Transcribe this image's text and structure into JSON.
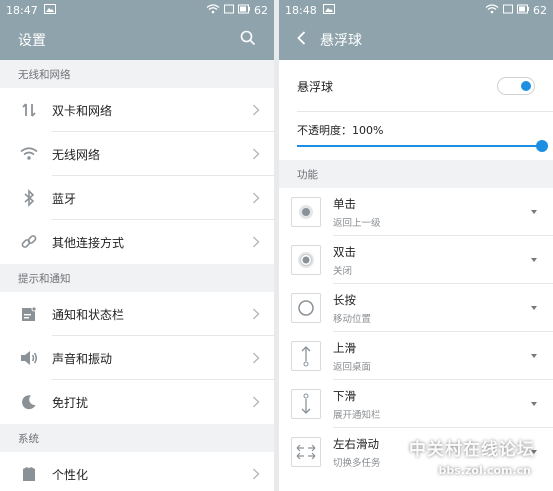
{
  "left": {
    "status": {
      "time": "18:47",
      "battery": "62"
    },
    "title": "设置",
    "sections": [
      {
        "label": "无线和网络",
        "items": [
          {
            "label": "双卡和网络",
            "icon": "dual-sim-icon"
          },
          {
            "label": "无线网络",
            "icon": "wifi-icon"
          },
          {
            "label": "蓝牙",
            "icon": "bluetooth-icon"
          },
          {
            "label": "其他连接方式",
            "icon": "link-icon"
          }
        ]
      },
      {
        "label": "提示和通知",
        "items": [
          {
            "label": "通知和状态栏",
            "icon": "notification-icon"
          },
          {
            "label": "声音和振动",
            "icon": "sound-icon"
          },
          {
            "label": "免打扰",
            "icon": "moon-icon"
          }
        ]
      },
      {
        "label": "系统",
        "items": [
          {
            "label": "个性化",
            "icon": "personalize-icon"
          }
        ]
      }
    ]
  },
  "right": {
    "status": {
      "time": "18:48",
      "battery": "62"
    },
    "title": "悬浮球",
    "toggle_label": "悬浮球",
    "toggle_on": true,
    "opacity_label": "不透明度：100%",
    "opacity_value": 1.0,
    "section_label": "功能",
    "functions": [
      {
        "title": "单击",
        "sub": "返回上一级",
        "icon": "dot-icon"
      },
      {
        "title": "双击",
        "sub": "关闭",
        "icon": "double-dot-icon"
      },
      {
        "title": "长按",
        "sub": "移动位置",
        "icon": "circle-icon"
      },
      {
        "title": "上滑",
        "sub": "返回桌面",
        "icon": "swipe-up-icon"
      },
      {
        "title": "下滑",
        "sub": "展开通知栏",
        "icon": "swipe-down-icon"
      },
      {
        "title": "左右滑动",
        "sub": "切换多任务",
        "icon": "swipe-horizontal-icon"
      }
    ]
  },
  "watermark": {
    "main": "中关村在线论坛",
    "url": "bbs.zol.com.cn"
  },
  "colors": {
    "appbar": "#8fa3ad",
    "accent": "#1d8fe3"
  }
}
